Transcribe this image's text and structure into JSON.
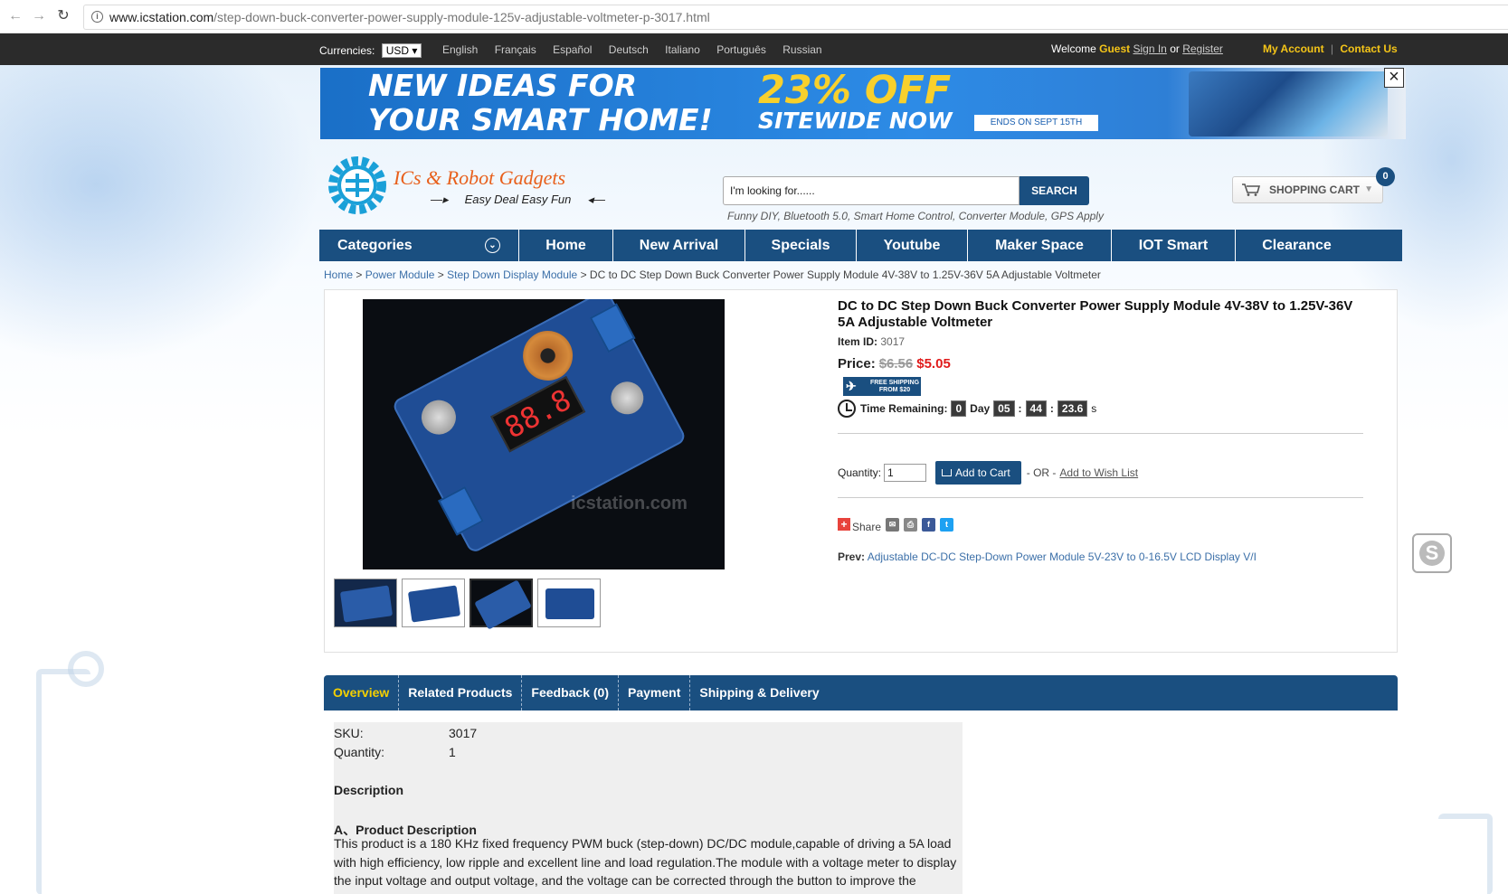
{
  "browser": {
    "url_domain": "www.icstation.com",
    "url_path": "/step-down-buck-converter-power-supply-module-125v-adjustable-voltmeter-p-3017.html"
  },
  "topbar": {
    "currencies_label": "Currencies:",
    "currency": "USD",
    "languages": [
      "English",
      "Français",
      "Español",
      "Deutsch",
      "Italiano",
      "Português",
      "Russian"
    ],
    "welcome": "Welcome",
    "guest": "Guest",
    "sign_in": "Sign In",
    "or": "or",
    "register": "Register",
    "my_account": "My Account",
    "separator": "|",
    "contact_us": "Contact Us"
  },
  "banner": {
    "line1": "NEW IDEAS FOR",
    "line2": "YOUR SMART HOME!",
    "offer1": "23% OFF",
    "offer2": "SITEWIDE NOW",
    "ends": "ENDS ON SEPT 15TH"
  },
  "header": {
    "logo_title": "ICs & Robot Gadgets",
    "logo_tagline": "Easy Deal Easy Fun",
    "search_placeholder": "I'm looking for......",
    "search_button": "SEARCH",
    "hotwords": "Funny DIY, Bluetooth 5.0, Smart Home Control, Converter Module, GPS Apply",
    "cart_label": "SHOPPING CART",
    "cart_count": "0"
  },
  "nav": {
    "categories": "Categories",
    "items": [
      "Home",
      "New Arrival",
      "Specials",
      "Youtube",
      "Maker Space",
      "IOT Smart",
      "Clearance"
    ]
  },
  "breadcrumb": {
    "items": [
      "Home",
      "Power Module",
      "Step Down Display Module"
    ],
    "sep": ">",
    "current": "DC to DC Step Down Buck Converter Power Supply Module 4V-38V to 1.25V-36V 5A Adjustable Voltmeter"
  },
  "product": {
    "title": "DC to DC Step Down Buck Converter Power Supply Module 4V-38V to 1.25V-36V 5A Adjustable Voltmeter",
    "item_id_label": "Item ID:",
    "item_id": "3017",
    "price_label": "Price:",
    "old_price": "$6.56",
    "new_price": "$5.05",
    "free_shipping": "FREE SHIPPING FROM $20",
    "time_label": "Time Remaining:",
    "days": "0",
    "day_label": "Day",
    "hours": "05",
    "minutes": "44",
    "seconds": "23.6",
    "s_label": "s",
    "colon": ":",
    "qty_label": "Quantity:",
    "qty_value": "1",
    "add_to_cart": "Add to Cart",
    "or_text": "- OR -",
    "wish_list": "Add to Wish List",
    "share_label": "Share",
    "prev_label": "Prev:",
    "prev_link": "Adjustable DC-DC Step-Down Power Module 5V-23V to 0-16.5V LCD Display V/I",
    "display_digits": "88.8",
    "watermark": "icstation.com"
  },
  "tabs": [
    "Overview",
    "Related Products",
    "Feedback (0)",
    "Payment",
    "Shipping & Delivery"
  ],
  "details": {
    "sku_label": "SKU:",
    "sku": "3017",
    "qty_label": "Quantity:",
    "qty": "1",
    "description_heading": "Description",
    "sub_heading": "A、Product Description",
    "paragraph": "This product is a 180 KHz fixed frequency PWM buck (step-down) DC/DC module,capable of driving a 5A load with high efficiency, low ripple and excellent line and load regulation.The module with a voltage meter to display the input voltage and output voltage, and the voltage can be corrected through the button to improve the"
  },
  "colors": {
    "brand_blue": "#1a4f80",
    "sale_red": "#e01b1b",
    "accent_yellow": "#f5c518",
    "logo_orange": "#e8601c"
  }
}
